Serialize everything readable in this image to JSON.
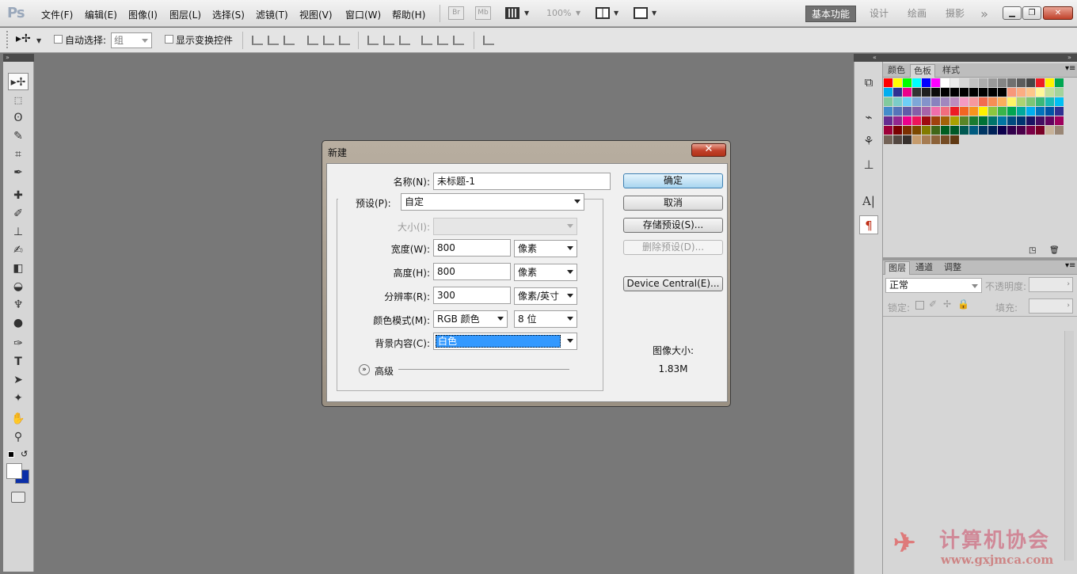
{
  "app": {
    "logo": "Ps"
  },
  "menu": [
    "文件(F)",
    "编辑(E)",
    "图像(I)",
    "图层(L)",
    "选择(S)",
    "滤镜(T)",
    "视图(V)",
    "窗口(W)",
    "帮助(H)"
  ],
  "menubar": {
    "br_label": "Br",
    "mb_label": "Mb",
    "zoom": "100%"
  },
  "workspaces": {
    "active": "基本功能",
    "items": [
      "设计",
      "绘画",
      "摄影"
    ],
    "more": "»"
  },
  "options": {
    "auto_select": "自动选择:",
    "auto_select_value": "组",
    "show_transform": "显示变换控件"
  },
  "panels": {
    "swatch_tabs": [
      "颜色",
      "色板",
      "样式"
    ],
    "layer_tabs": [
      "图层",
      "通道",
      "调整"
    ],
    "blend_mode": "正常",
    "opacity_label": "不透明度:",
    "lock_label": "锁定:",
    "fill_label": "填充:"
  },
  "swatch_colors": [
    "#ff0000",
    "#ffff00",
    "#00ff00",
    "#00ffff",
    "#0000ff",
    "#ff00ff",
    "#ffffff",
    "#ebebeb",
    "#d6d6d6",
    "#c2c2c2",
    "#adadad",
    "#999999",
    "#858585",
    "#707070",
    "#5c5c5c",
    "#474747",
    "#ed1c24",
    "#fff200",
    "#00a651",
    "#00aeef",
    "#2e3192",
    "#ec008c",
    "#333333",
    "#1f1f1f",
    "#0a0a0a",
    "#000000",
    "#000000",
    "#000000",
    "#000000",
    "#000000",
    "#000000",
    "#000000",
    "#f7977a",
    "#fbad82",
    "#fdc68a",
    "#fff799",
    "#c4df9b",
    "#a3d39c",
    "#82ca9d",
    "#7bcdc8",
    "#6ecff6",
    "#7ea7d8",
    "#8493ca",
    "#8882be",
    "#a187be",
    "#bc8cbf",
    "#f49ac2",
    "#f6989d",
    "#f26c4f",
    "#f68e55",
    "#fbaf5c",
    "#fff467",
    "#acd372",
    "#7cc576",
    "#3bb878",
    "#1abbb4",
    "#00bff3",
    "#438ccb",
    "#5574b9",
    "#605ca8",
    "#855fa8",
    "#a763a8",
    "#f06eaa",
    "#f26d7d",
    "#ed1c24",
    "#f26522",
    "#f7941d",
    "#fff200",
    "#8dc73f",
    "#39b54a",
    "#00a651",
    "#00a99d",
    "#00aeef",
    "#0072bc",
    "#0054a6",
    "#2e3192",
    "#662d91",
    "#92278f",
    "#ec008c",
    "#ed145b",
    "#9e0b0f",
    "#a0410d",
    "#a36209",
    "#aba000",
    "#598527",
    "#1a7b30",
    "#007236",
    "#00746b",
    "#0076a3",
    "#004b80",
    "#003471",
    "#1b1464",
    "#440e62",
    "#630460",
    "#9e005d",
    "#9e0039",
    "#790000",
    "#7b2e00",
    "#7d4900",
    "#827b00",
    "#406618",
    "#005e20",
    "#005826",
    "#005952",
    "#005b7f",
    "#003663",
    "#002157",
    "#0d004c",
    "#32004b",
    "#4b0049",
    "#7b0046",
    "#7a0026",
    "#c7b299",
    "#998675",
    "#736357",
    "#534741",
    "#37302d",
    "#c69c6d",
    "#a67c52",
    "#8c6239",
    "#754c24",
    "#603913"
  ],
  "dialog": {
    "title": "新建",
    "name_label": "名称(N):",
    "name_value": "未标题-1",
    "preset_label": "预设(P):",
    "preset_value": "自定",
    "size_label": "大小(I):",
    "width_label": "宽度(W):",
    "width_value": "800",
    "width_unit": "像素",
    "height_label": "高度(H):",
    "height_value": "800",
    "height_unit": "像素",
    "resolution_label": "分辨率(R):",
    "resolution_value": "300",
    "resolution_unit": "像素/英寸",
    "color_mode_label": "颜色模式(M):",
    "color_mode_value": "RGB 颜色",
    "bit_depth": "8 位",
    "background_label": "背景内容(C):",
    "background_value": "白色",
    "advanced": "高级",
    "ok": "确定",
    "cancel": "取消",
    "save_preset": "存储预设(S)...",
    "delete_preset": "删除预设(D)...",
    "device_central": "Device Central(E)...",
    "image_size_label": "图像大小:",
    "image_size_value": "1.83M"
  },
  "watermark": {
    "text": "计算机协会",
    "url": "www.gxjmca.com"
  }
}
